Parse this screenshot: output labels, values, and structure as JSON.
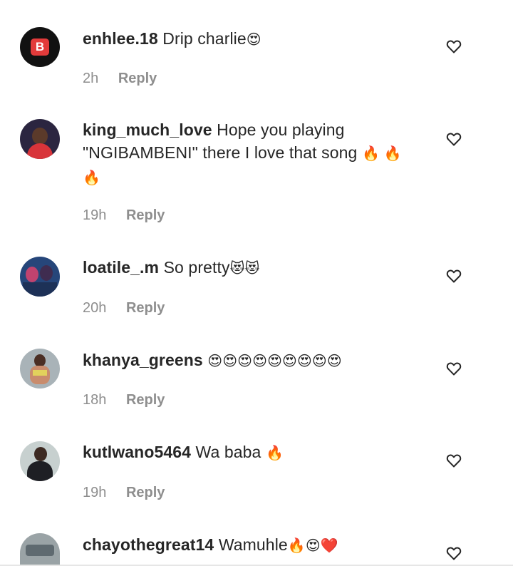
{
  "comments": [
    {
      "username": "enhlee.18",
      "text": "Drip charlie",
      "emoji": "😍",
      "time": "2h",
      "reply": "Reply",
      "avatar_icon": "b-badge-icon"
    },
    {
      "username": "king_much_love",
      "text": "Hope you playing \"NGIBAMBENI\" there I love that song",
      "emoji": "🔥 🔥 🔥",
      "time": "19h",
      "reply": "Reply",
      "avatar_icon": "user-photo"
    },
    {
      "username": "loatile_.m",
      "text": "So pretty",
      "emoji": "😻😻",
      "time": "20h",
      "reply": "Reply",
      "avatar_icon": "user-photo"
    },
    {
      "username": "khanya_greens",
      "text": "",
      "emoji": "😍😍😍😍😍😍😍😍😍",
      "time": "18h",
      "reply": "Reply",
      "avatar_icon": "user-photo"
    },
    {
      "username": "kutlwano5464",
      "text": "Wa baba",
      "emoji": "🔥",
      "time": "19h",
      "reply": "Reply",
      "avatar_icon": "user-photo"
    },
    {
      "username": "chayothegreat14",
      "text": "Wamuhle",
      "emoji": "🔥😍❤️",
      "time": "",
      "reply": "",
      "avatar_icon": "user-photo"
    }
  ],
  "avatar_badge_letter": "B",
  "colors": {
    "text": "#262626",
    "meta": "#8e8e8e",
    "badge_bg": "#111111",
    "badge_red": "#e23b3b"
  }
}
